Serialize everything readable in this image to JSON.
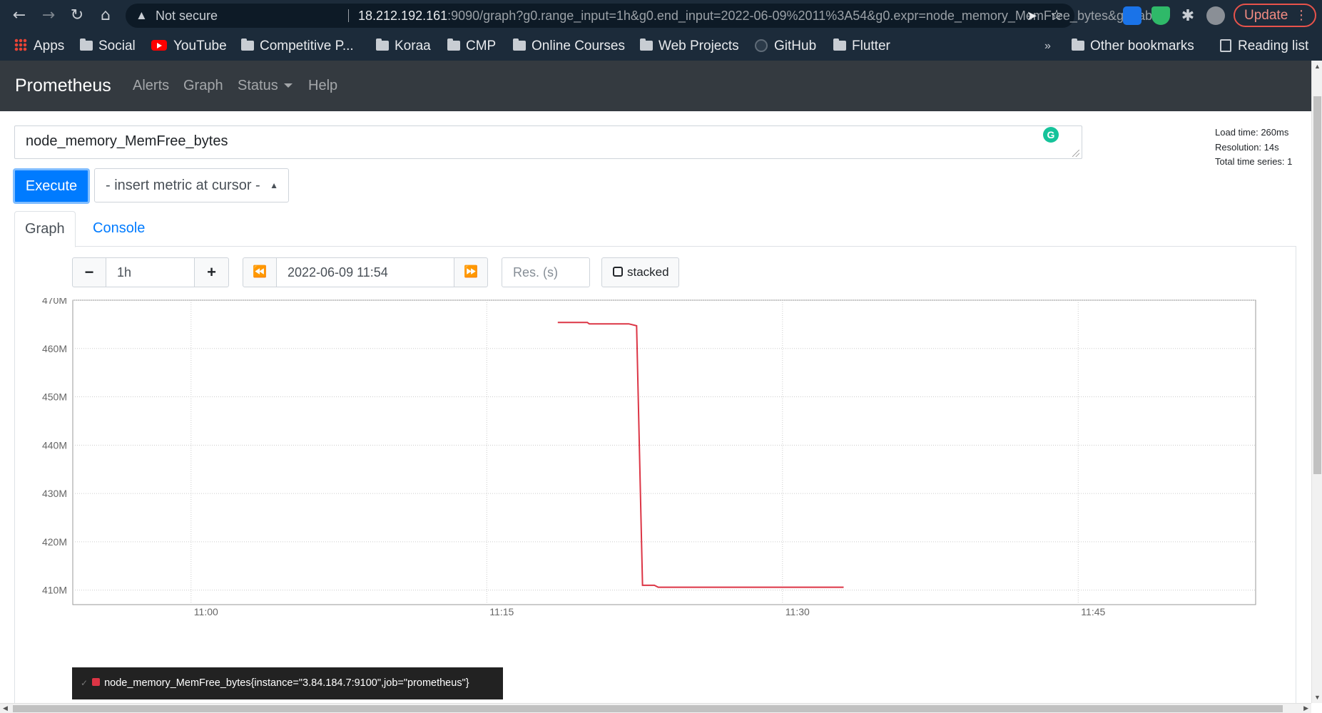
{
  "browser": {
    "security_label": "Not secure",
    "url_host": "18.212.192.161",
    "url_rest": ":9090/graph?g0.range_input=1h&g0.end_input=2022-06-09%2011%3A54&g0.expr=node_memory_MemFree_bytes&g0.tab=0...",
    "update_label": "Update"
  },
  "bookmarks": [
    {
      "label": "Apps",
      "icon": "apps-grid-icon"
    },
    {
      "label": "Social",
      "icon": "folder-icon"
    },
    {
      "label": "YouTube",
      "icon": "youtube-icon"
    },
    {
      "label": "Competitive P...",
      "icon": "folder-icon"
    },
    {
      "label": "Koraa",
      "icon": "folder-icon"
    },
    {
      "label": "CMP",
      "icon": "folder-icon"
    },
    {
      "label": "Online Courses",
      "icon": "folder-icon"
    },
    {
      "label": "Web Projects",
      "icon": "folder-icon"
    },
    {
      "label": "GitHub",
      "icon": "github-icon"
    },
    {
      "label": "Flutter",
      "icon": "folder-icon"
    }
  ],
  "bookmarks_overflow": "»",
  "other_bookmarks": "Other bookmarks",
  "reading_list": "Reading list",
  "nav": {
    "brand": "Prometheus",
    "links": [
      "Alerts",
      "Graph",
      "Status",
      "Help"
    ]
  },
  "query": {
    "expression": "node_memory_MemFree_bytes",
    "execute_label": "Execute",
    "insert_metric_label": "- insert metric at cursor -"
  },
  "stats": {
    "load_time": "Load time: 260ms",
    "resolution": "Resolution: 14s",
    "total_series": "Total time series: 1"
  },
  "tabs": {
    "graph": "Graph",
    "console": "Console"
  },
  "controls": {
    "minus": "−",
    "range": "1h",
    "plus": "+",
    "back": "⏪",
    "end_time": "2022-06-09 11:54",
    "forward": "⏩",
    "resolution_placeholder": "Res. (s)",
    "stacked_label": "stacked"
  },
  "colors": {
    "series": "#dc3545",
    "accent": "#007bff",
    "navbar": "#343a40"
  },
  "chart_data": {
    "type": "line",
    "ylim": [
      407000000,
      470000000
    ],
    "yticks": [
      {
        "v": 410000000,
        "label": "410M"
      },
      {
        "v": 420000000,
        "label": "420M"
      },
      {
        "v": 430000000,
        "label": "430M"
      },
      {
        "v": 440000000,
        "label": "440M"
      },
      {
        "v": 450000000,
        "label": "450M"
      },
      {
        "v": 460000000,
        "label": "460M"
      },
      {
        "v": 470000000,
        "label": "470M"
      }
    ],
    "xlim": [
      "10:54",
      "11:54"
    ],
    "xticks": [
      {
        "v": "11:00",
        "label": "11:00"
      },
      {
        "v": "11:15",
        "label": "11:15"
      },
      {
        "v": "11:30",
        "label": "11:30"
      },
      {
        "v": "11:45",
        "label": "11:45"
      }
    ],
    "grid": true,
    "series": [
      {
        "name": "node_memory_MemFree_bytes{instance=\"3.84.184.7:9100\",job=\"prometheus\"}",
        "points": [
          [
            "11:18.6",
            465400000
          ],
          [
            "11:20.1",
            465400000
          ],
          [
            "11:20.2",
            465100000
          ],
          [
            "11:22.2",
            465100000
          ],
          [
            "11:22.6",
            464700000
          ],
          [
            "11:22.9",
            411000000
          ],
          [
            "11:23.5",
            411000000
          ],
          [
            "11:23.7",
            410600000
          ],
          [
            "11:33.1",
            410600000
          ]
        ]
      }
    ]
  }
}
